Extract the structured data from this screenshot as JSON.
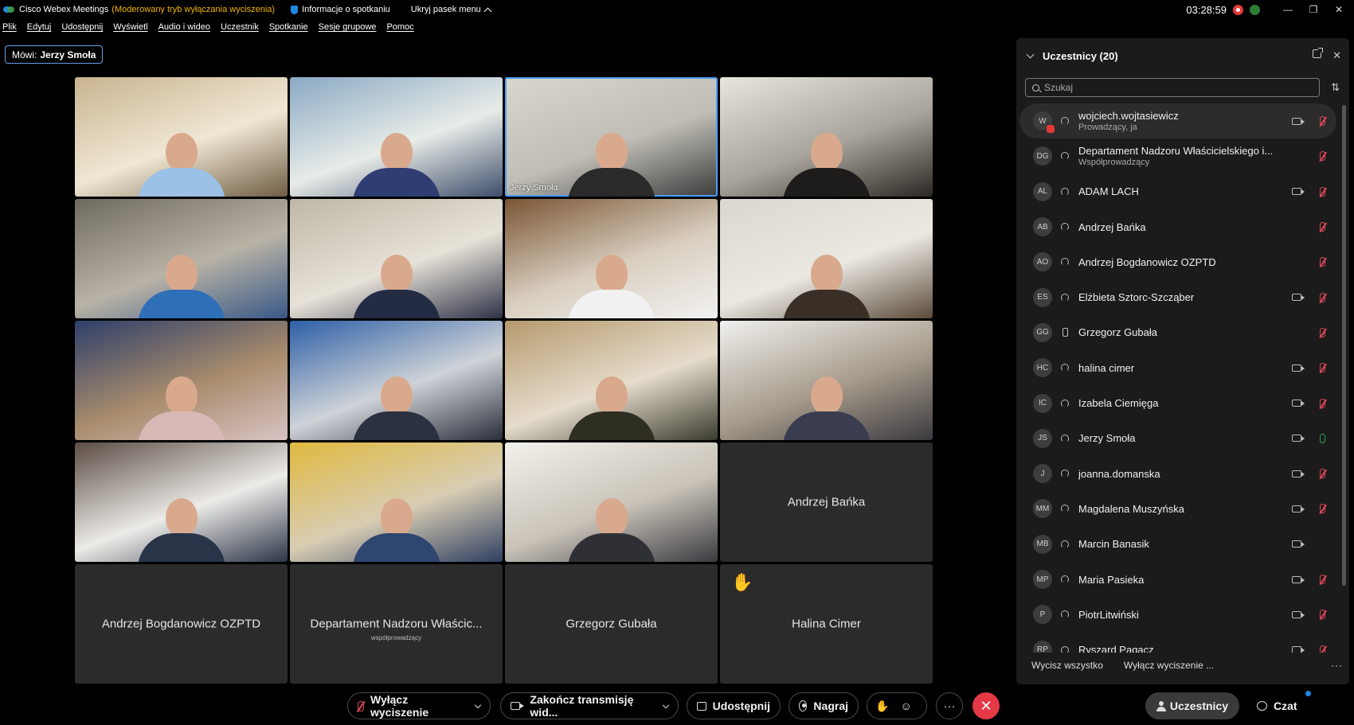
{
  "titlebar": {
    "app_name": "Cisco Webex Meetings",
    "mode": "(Moderowany tryb wyłączania wyciszenia)",
    "info": "Informacje o spotkaniu",
    "hide_menu": "Ukryj pasek menu",
    "clock": "03:28:59",
    "minimize": "—",
    "maximize": "❐",
    "close": "✕"
  },
  "menu": [
    "Plik",
    "Edytuj",
    "Udostępnij",
    "Wyświetl",
    "Audio i wideo",
    "Uczestnik",
    "Spotkanie",
    "Sesje grupowe",
    "Pomoc"
  ],
  "speaker": {
    "label": "Mówi:",
    "name": "Jerzy Smoła"
  },
  "tiles": [
    {
      "type": "video",
      "a": "#c9b48f",
      "b": "#efe7d4",
      "c": "#6f5c42",
      "shirt": "#9cc1e6",
      "name": ""
    },
    {
      "type": "video",
      "a": "#8aa9c4",
      "b": "#e8ece8",
      "c": "#3e4d6a",
      "shirt": "#2f3d72",
      "name": ""
    },
    {
      "type": "video",
      "a": "#d8d6cf",
      "b": "#bfbdb5",
      "c": "#3b3b3b",
      "shirt": "#2a2a2a",
      "name": "Jerzy Smoła",
      "active": true
    },
    {
      "type": "video",
      "a": "#e8e5df",
      "b": "#a9a49b",
      "c": "#2b2824",
      "shirt": "#1e1c1a",
      "name": ""
    },
    {
      "type": "video",
      "a": "#6f6a60",
      "b": "#b9b3a6",
      "c": "#395886",
      "shirt": "#2f6fb8",
      "name": ""
    },
    {
      "type": "video",
      "a": "#bfb7a7",
      "b": "#e7e2d8",
      "c": "#2d3246",
      "shirt": "#242c44",
      "name": ""
    },
    {
      "type": "video",
      "a": "#7a5533",
      "b": "#d9cfc0",
      "c": "#f2f2f2",
      "shirt": "#f1f1f1",
      "name": ""
    },
    {
      "type": "video",
      "a": "#dad6d0",
      "b": "#ebe8e2",
      "c": "#5a4b3a",
      "shirt": "#3a2f26",
      "name": ""
    },
    {
      "type": "video",
      "a": "#2e3f6a",
      "b": "#a88c6c",
      "c": "#d9c3c3",
      "shirt": "#d8b9b5",
      "name": ""
    },
    {
      "type": "video",
      "a": "#2d5fa6",
      "b": "#cfd3d8",
      "c": "#2a2e3a",
      "shirt": "#2b3140",
      "name": ""
    },
    {
      "type": "video",
      "a": "#b69a6e",
      "b": "#e5dccb",
      "c": "#3a3a2e",
      "shirt": "#2e2e23",
      "name": ""
    },
    {
      "type": "video",
      "a": "#f0f0ee",
      "b": "#a69b8b",
      "c": "#3c3a3f",
      "shirt": "#3a3d4f",
      "name": ""
    },
    {
      "type": "video",
      "a": "#5b4c44",
      "b": "#ecebe7",
      "c": "#2c3548",
      "shirt": "#2a3448",
      "name": ""
    },
    {
      "type": "video",
      "a": "#e0b93f",
      "b": "#d8cdb3",
      "c": "#2f3f62",
      "shirt": "#2e4670",
      "name": ""
    },
    {
      "type": "video",
      "a": "#f3f1ec",
      "b": "#c9c3b8",
      "c": "#3a3a40",
      "shirt": "#2f3036",
      "name": ""
    },
    {
      "type": "name",
      "label": "Andrzej Bańka"
    },
    {
      "type": "name",
      "label": "Andrzej Bogdanowicz OZPTD"
    },
    {
      "type": "name",
      "label": "Departament Nadzoru Właścic...",
      "sub": "współprowadzący"
    },
    {
      "type": "name",
      "label": "Grzegorz Gubała"
    },
    {
      "type": "name",
      "label": "Halina Cimer",
      "hand": "✋"
    }
  ],
  "panel": {
    "title": "Uczestnicy (20)",
    "search_placeholder": "Szukaj",
    "sort_icon": "⇅",
    "participants": [
      {
        "initials": "W",
        "name": "wojciech.wojtasiewicz",
        "role": "Prowadzący, ja",
        "device": "headset",
        "cam": true,
        "mic": "muted",
        "badge": true
      },
      {
        "initials": "DG",
        "name": "Departament Nadzoru Właścicielskiego i...",
        "role": "Współprowadzący",
        "device": "headset",
        "cam": false,
        "mic": "muted"
      },
      {
        "initials": "AL",
        "name": "ADAM LACH",
        "role": "",
        "device": "headset",
        "cam": true,
        "mic": "muted"
      },
      {
        "initials": "AB",
        "name": "Andrzej Bańka",
        "role": "",
        "device": "headset",
        "cam": false,
        "mic": "muted"
      },
      {
        "initials": "AO",
        "name": "Andrzej Bogdanowicz OZPTD",
        "role": "",
        "device": "headset",
        "cam": false,
        "mic": "muted"
      },
      {
        "initials": "ES",
        "name": "Elżbieta Sztorc-Szcząber",
        "role": "",
        "device": "headset",
        "cam": true,
        "mic": "muted"
      },
      {
        "initials": "GG",
        "name": "Grzegorz Gubała",
        "role": "",
        "device": "phone",
        "cam": false,
        "mic": "muted"
      },
      {
        "initials": "HC",
        "name": "halina cimer",
        "role": "",
        "device": "headset",
        "cam": true,
        "mic": "muted"
      },
      {
        "initials": "IC",
        "name": "Izabela Ciemięga",
        "role": "",
        "device": "headset",
        "cam": true,
        "mic": "muted"
      },
      {
        "initials": "JS",
        "name": "Jerzy Smoła",
        "role": "",
        "device": "headset",
        "cam": true,
        "mic": "on"
      },
      {
        "initials": "J",
        "name": "joanna.domanska",
        "role": "",
        "device": "headset",
        "cam": true,
        "mic": "muted"
      },
      {
        "initials": "MM",
        "name": "Magdalena Muszyńska",
        "role": "",
        "device": "headset",
        "cam": true,
        "mic": "muted"
      },
      {
        "initials": "MB",
        "name": "Marcin Banasik",
        "role": "",
        "device": "headset",
        "cam": true,
        "mic": "none"
      },
      {
        "initials": "MP",
        "name": "Maria Pasieka",
        "role": "",
        "device": "headset",
        "cam": true,
        "mic": "muted"
      },
      {
        "initials": "P",
        "name": "PiotrLitwiński",
        "role": "",
        "device": "headset",
        "cam": true,
        "mic": "muted"
      },
      {
        "initials": "RP",
        "name": "Ryszard Pagacz",
        "role": "",
        "device": "headset",
        "cam": true,
        "mic": "muted"
      }
    ],
    "mute_all": "Wycisz wszystko",
    "unmute_all": "Wyłącz wyciszenie ...",
    "more": "···"
  },
  "toolbar": {
    "unmute": "Wyłącz wyciszenie",
    "stop_video": "Zakończ transmisję wid...",
    "share": "Udostępnij",
    "record": "Nagraj",
    "hand_icon": "✋",
    "emoji_icon": "☺",
    "more_icon": "···",
    "end_icon": "✕",
    "participants": "Uczestnicy",
    "chat": "Czat"
  }
}
